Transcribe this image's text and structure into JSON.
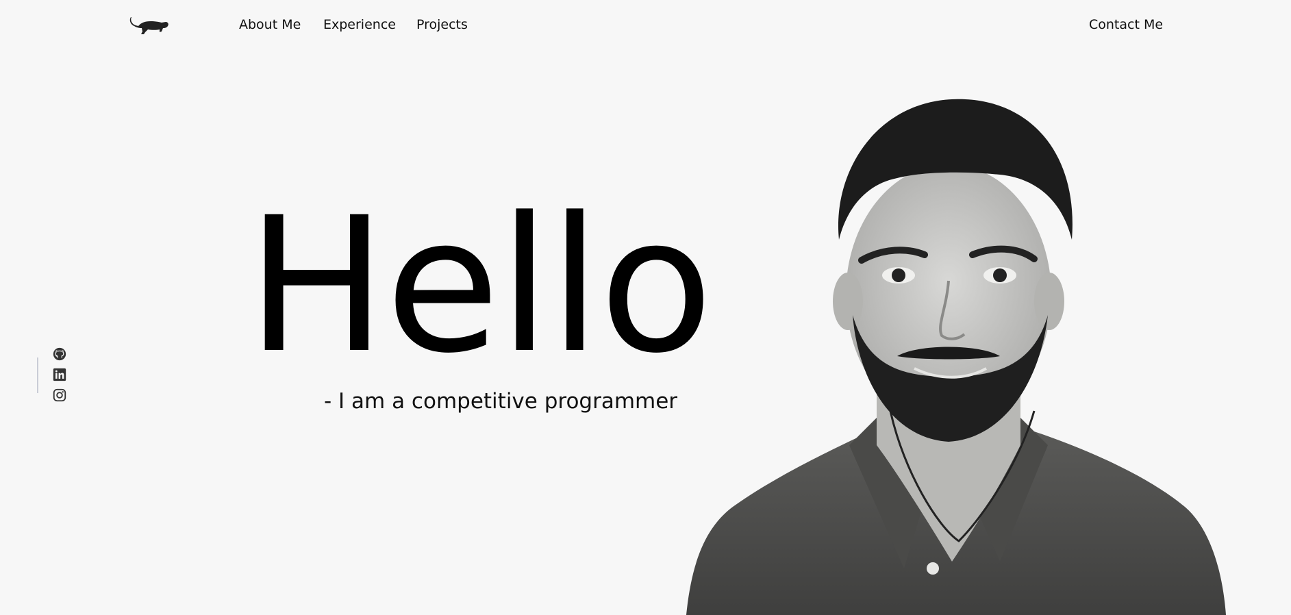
{
  "header": {
    "nav": [
      "About Me",
      "Experience",
      "Projects"
    ],
    "contact_label": "Contact Me"
  },
  "hero": {
    "title": "Hello",
    "subtitle": "- I am a competitive programmer"
  },
  "social": {
    "icons": [
      "github-icon",
      "linkedin-icon",
      "instagram-icon"
    ]
  }
}
